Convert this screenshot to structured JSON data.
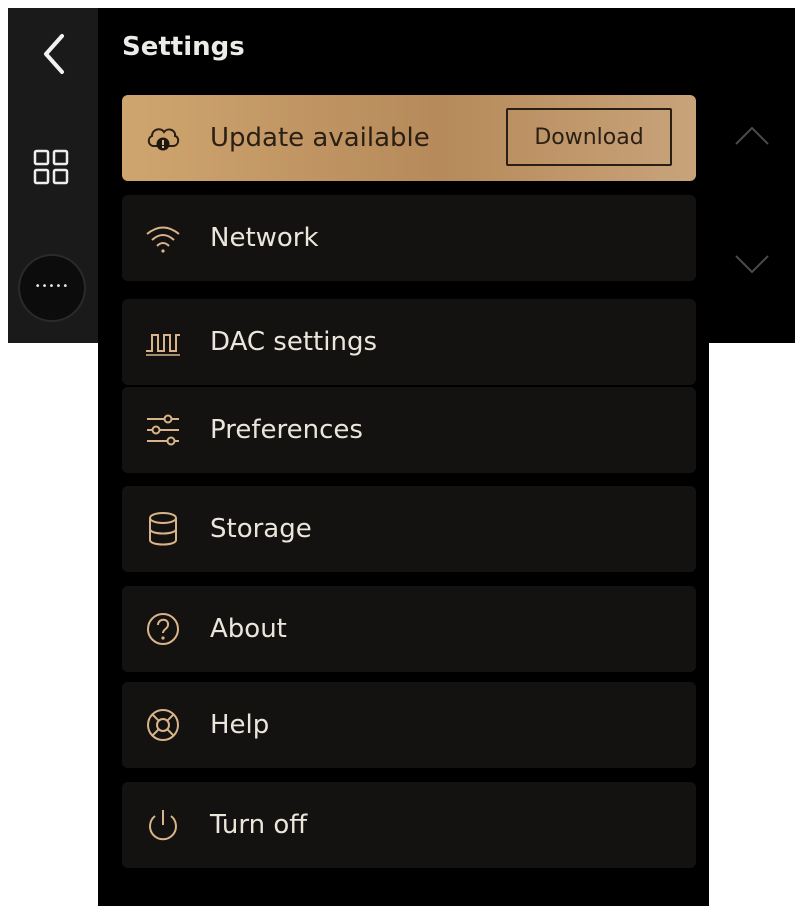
{
  "header": {
    "title": "Settings"
  },
  "nav": {
    "back_icon": "chevron-left-icon",
    "apps_icon": "grid-icon",
    "more_label": "•••••"
  },
  "update": {
    "label": "Update available",
    "button_label": "Download",
    "icon": "cloud-alert-icon"
  },
  "menu": {
    "items": [
      {
        "label": "Network",
        "icon": "wifi-icon"
      },
      {
        "label": "DAC settings",
        "icon": "waveform-icon"
      },
      {
        "label": "Preferences",
        "icon": "sliders-icon"
      },
      {
        "label": "Storage",
        "icon": "database-icon"
      },
      {
        "label": "About",
        "icon": "question-circle-icon"
      },
      {
        "label": "Help",
        "icon": "lifebuoy-icon"
      },
      {
        "label": "Turn off",
        "icon": "power-icon"
      }
    ]
  },
  "colors": {
    "accent_gold": "#c49a66",
    "row_background": "#141210",
    "icon_color": "#d8b48a",
    "background": "#000000"
  }
}
